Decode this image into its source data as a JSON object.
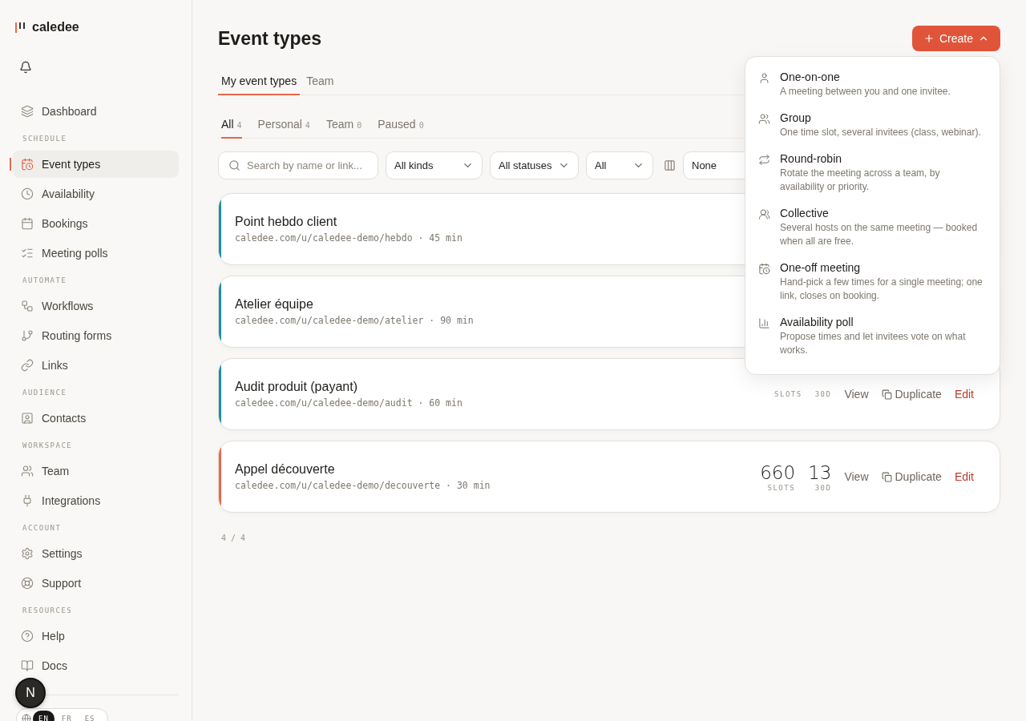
{
  "brand": {
    "name": "caledee"
  },
  "sidebar": {
    "sections": [
      {
        "items": [
          {
            "label": "Dashboard",
            "selected": false
          }
        ]
      },
      {
        "title": "SCHEDULE",
        "items": [
          {
            "label": "Event types",
            "selected": true
          },
          {
            "label": "Availability",
            "selected": false
          },
          {
            "label": "Bookings",
            "selected": false
          },
          {
            "label": "Meeting polls",
            "selected": false
          }
        ]
      },
      {
        "title": "AUTOMATE",
        "items": [
          {
            "label": "Workflows",
            "selected": false
          },
          {
            "label": "Routing forms",
            "selected": false
          },
          {
            "label": "Links",
            "selected": false
          }
        ]
      },
      {
        "title": "AUDIENCE",
        "items": [
          {
            "label": "Contacts",
            "selected": false
          }
        ]
      },
      {
        "title": "WORKSPACE",
        "items": [
          {
            "label": "Team",
            "selected": false
          },
          {
            "label": "Integrations",
            "selected": false
          }
        ]
      },
      {
        "title": "ACCOUNT",
        "items": [
          {
            "label": "Settings",
            "selected": false
          },
          {
            "label": "Support",
            "selected": false
          }
        ]
      },
      {
        "title": "RESOURCES",
        "items": [
          {
            "label": "Help",
            "selected": false
          },
          {
            "label": "Docs",
            "selected": false
          }
        ]
      }
    ],
    "avatar": "N",
    "languages": [
      {
        "label": "EN",
        "selected": true
      },
      {
        "label": "FR",
        "selected": false
      },
      {
        "label": "ES",
        "selected": false
      }
    ]
  },
  "page": {
    "title": "Event types",
    "create_button": "Create",
    "tabs": [
      {
        "label": "My event types",
        "selected": true
      },
      {
        "label": "Team",
        "selected": false
      }
    ],
    "filter_tabs": [
      {
        "label": "All",
        "count": "4",
        "selected": true
      },
      {
        "label": "Personal",
        "count": "4",
        "selected": false
      },
      {
        "label": "Team",
        "count": "0",
        "selected": false
      },
      {
        "label": "Paused",
        "count": "0",
        "selected": false
      }
    ],
    "search": {
      "placeholder": "Search by name or link..."
    },
    "filters": [
      {
        "value": "All kinds"
      },
      {
        "value": "All statuses"
      },
      {
        "value": "All"
      }
    ],
    "sort": {
      "value": "None"
    },
    "event_types": [
      {
        "name": "Point hebdo client",
        "link": "caledee.com/u/caledee-demo/hebdo · 45 min",
        "color": "#1a8ea6"
      },
      {
        "name": "Atelier équipe",
        "link": "caledee.com/u/caledee-demo/atelier · 90 min",
        "color": "#1a8ea6"
      },
      {
        "name": "Audit produit (payant)",
        "link": "caledee.com/u/caledee-demo/audit · 60 min",
        "color": "#1a8ea6",
        "slots_label": "SLOTS",
        "days_label": "30D",
        "actions": [
          "View",
          "Duplicate",
          "Edit"
        ]
      },
      {
        "name": "Appel découverte",
        "link": "caledee.com/u/caledee-demo/decouverte · 30 min",
        "color": "#e8674a",
        "slots": "660",
        "slots_label": "SLOTS",
        "days": "13",
        "days_label": "30D",
        "actions": [
          "View",
          "Duplicate",
          "Edit"
        ]
      }
    ],
    "footer": "4 / 4"
  },
  "create_menu": {
    "items": [
      {
        "title": "One-on-one",
        "description": "A meeting between you and one invitee."
      },
      {
        "title": "Group",
        "description": "One time slot, several invitees (class, webinar)."
      },
      {
        "title": "Round-robin",
        "description": "Rotate the meeting across a team, by availability or priority."
      },
      {
        "title": "Collective",
        "description": "Several hosts on the same meeting — booked when all are free."
      },
      {
        "title": "One-off meeting",
        "description": "Hand-pick a few times for a single meeting; one link, closes on booking."
      },
      {
        "title": "Availability poll",
        "description": "Propose times and let invitees vote on what works."
      }
    ]
  }
}
